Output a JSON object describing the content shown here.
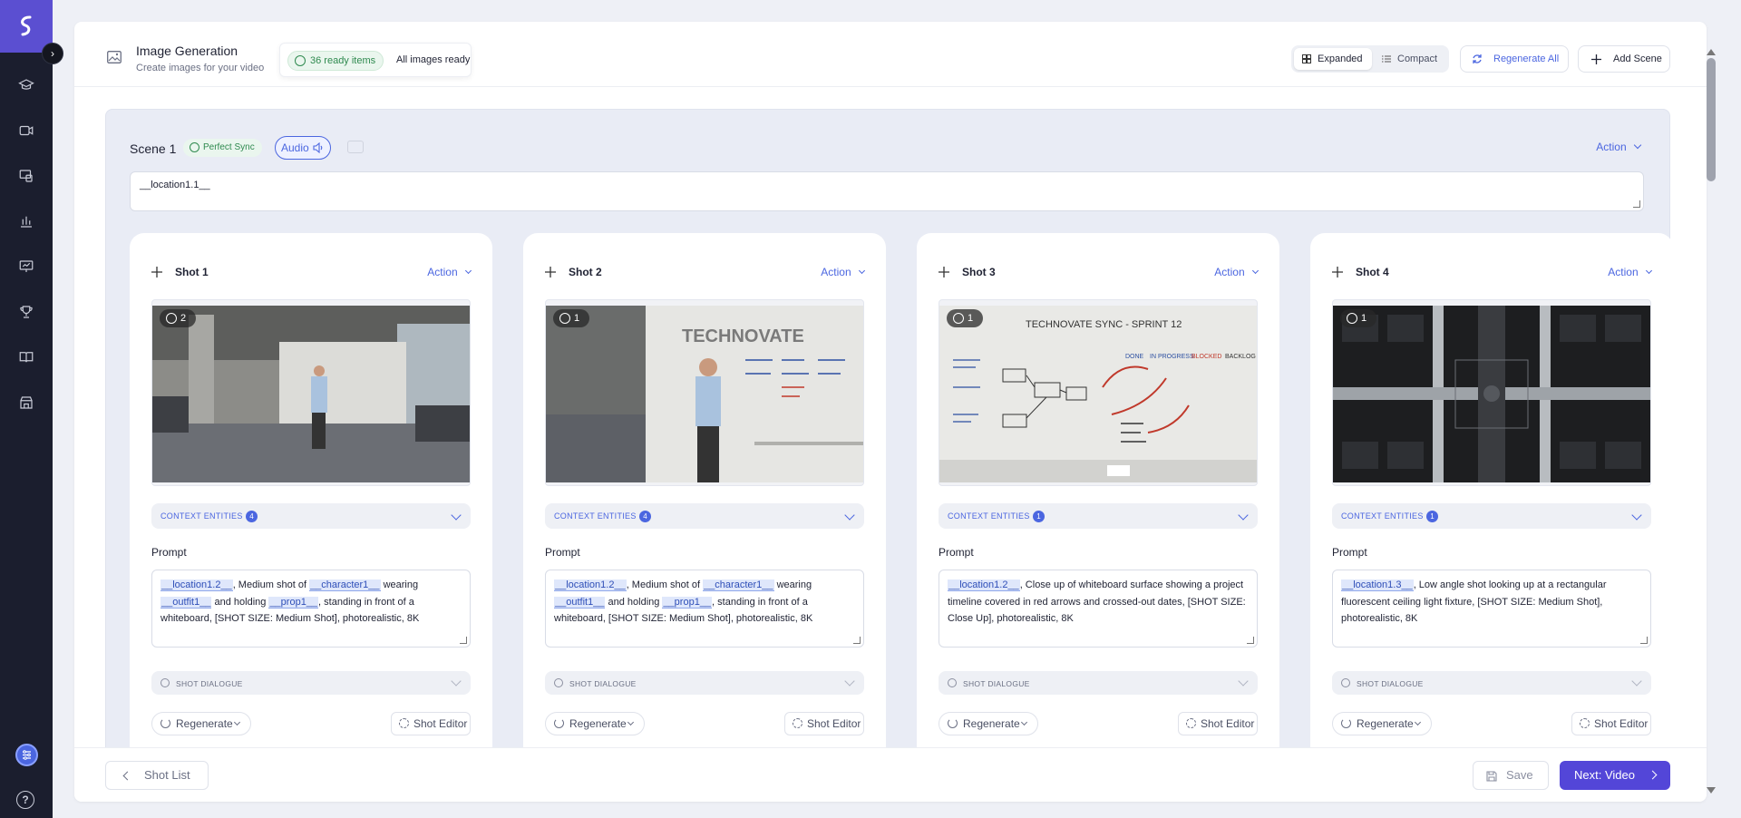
{
  "header": {
    "title": "Image Generation",
    "subtitle": "Create images for your video",
    "ready_badge": "36 ready items",
    "ready_text": "All images ready",
    "view_expanded": "Expanded",
    "view_compact": "Compact",
    "regenerate_all": "Regenerate All",
    "add_scene": "Add Scene"
  },
  "scene": {
    "title": "Scene 1",
    "sync_badge": "Perfect Sync",
    "audio_label": "Audio",
    "action_label": "Action",
    "description": "__location1.1__"
  },
  "shots": [
    {
      "title": "Shot 1",
      "action_label": "Action",
      "versions": "2",
      "context_label": "CONTEXT ENTITIES",
      "context_count": "4",
      "prompt_label": "Prompt",
      "prompt": {
        "t1": "__location1.2__",
        "s1": ", Medium shot of ",
        "t2": "__character1__",
        "s2": " wearing ",
        "t3": "__outfit1__",
        "s3": " and holding ",
        "t4": "__prop1__",
        "s4": ", standing in front of a whiteboard, [SHOT SIZE: Medium Shot], photorealistic, 8K"
      },
      "dialogue_label": "SHOT DIALOGUE",
      "regenerate_label": "Regenerate",
      "editor_label": "Shot Editor"
    },
    {
      "title": "Shot 2",
      "action_label": "Action",
      "versions": "1",
      "context_label": "CONTEXT ENTITIES",
      "context_count": "4",
      "prompt_label": "Prompt",
      "prompt": {
        "t1": "__location1.2__",
        "s1": ", Medium shot of ",
        "t2": "__character1__",
        "s2": " wearing ",
        "t3": "__outfit1__",
        "s3": " and holding ",
        "t4": "__prop1__",
        "s4": ", standing in front of a whiteboard, [SHOT SIZE: Medium Shot], photorealistic, 8K"
      },
      "dialogue_label": "SHOT DIALOGUE",
      "regenerate_label": "Regenerate",
      "editor_label": "Shot Editor"
    },
    {
      "title": "Shot 3",
      "action_label": "Action",
      "versions": "1",
      "context_label": "CONTEXT ENTITIES",
      "context_count": "1",
      "prompt_label": "Prompt",
      "prompt": {
        "t1": "__location1.2__",
        "s1": ", Close up of whiteboard surface showing a project timeline covered in red arrows and crossed-out dates, [SHOT SIZE: Close Up], photorealistic, 8K"
      },
      "dialogue_label": "SHOT DIALOGUE",
      "regenerate_label": "Regenerate",
      "editor_label": "Shot Editor"
    },
    {
      "title": "Shot 4",
      "action_label": "Action",
      "versions": "1",
      "context_label": "CONTEXT ENTITIES",
      "context_count": "1",
      "prompt_label": "Prompt",
      "prompt": {
        "t1": "__location1.3__",
        "s1": ", Low angle shot looking up at a rectangular fluorescent ceiling light fixture, [SHOT SIZE: Medium Shot], photorealistic, 8K"
      },
      "dialogue_label": "SHOT DIALOGUE",
      "regenerate_label": "Regenerate",
      "editor_label": "Shot Editor"
    }
  ],
  "whiteboard": {
    "brand": "TECHNOVATE",
    "heading": "TECHNOVATE SYNC - SPRINT 12",
    "col_done": "DONE",
    "col_progress": "IN PROGRESS",
    "col_blocked": "BLOCKED",
    "col_backlog": "BACKLOG"
  },
  "footer": {
    "shot_list": "Shot List",
    "save": "Save",
    "next": "Next: Video"
  },
  "colors": {
    "sidebar": "#1b1e2e",
    "brand": "#5b4fd1",
    "accent": "#4b66e0",
    "primary_button": "#5346d8",
    "success": "#2f8a4f"
  },
  "icons": {
    "nav": [
      "graduation-cap-icon",
      "video-camera-icon",
      "screens-icon",
      "bar-chart-icon",
      "presentation-icon",
      "trophy-icon",
      "book-icon",
      "store-icon"
    ]
  }
}
